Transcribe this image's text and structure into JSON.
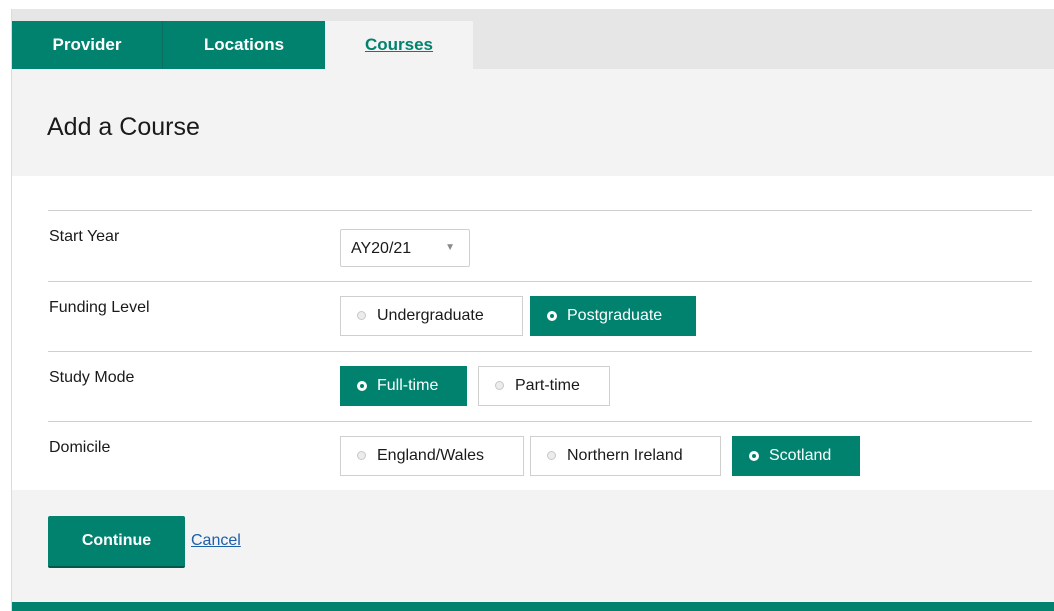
{
  "tabs": {
    "provider": "Provider",
    "locations": "Locations",
    "courses": "Courses"
  },
  "page": {
    "title": "Add a Course"
  },
  "form": {
    "start_year": {
      "label": "Start Year",
      "value": "AY20/21"
    },
    "funding_level": {
      "label": "Funding Level",
      "options": [
        "Undergraduate",
        "Postgraduate"
      ],
      "selected": "Postgraduate"
    },
    "study_mode": {
      "label": "Study Mode",
      "options": [
        "Full-time",
        "Part-time"
      ],
      "selected": "Full-time"
    },
    "domicile": {
      "label": "Domicile",
      "options": [
        "England/Wales",
        "Northern Ireland",
        "Scotland"
      ],
      "selected": "Scotland"
    }
  },
  "actions": {
    "continue_label": "Continue",
    "cancel_label": "Cancel"
  },
  "colors": {
    "accent": "#00826f",
    "link": "#1d5fa8"
  },
  "icons": {
    "dropdown": "caret-down-icon",
    "radio": "radio-icon"
  }
}
